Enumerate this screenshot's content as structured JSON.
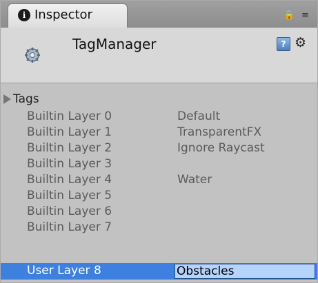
{
  "tab": {
    "label": "Inspector",
    "info_glyph": "i",
    "lock_glyph": "🔒",
    "menu_glyph": "≡"
  },
  "header": {
    "title": "TagManager",
    "component_icon": "gear-icon",
    "help_glyph": "?",
    "settings_glyph": "⚙"
  },
  "tags": {
    "foldout_label": "Tags"
  },
  "layers": [
    {
      "name": "Builtin Layer 0",
      "value": "Default"
    },
    {
      "name": "Builtin Layer 1",
      "value": "TransparentFX"
    },
    {
      "name": "Builtin Layer 2",
      "value": "Ignore Raycast"
    },
    {
      "name": "Builtin Layer 3",
      "value": ""
    },
    {
      "name": "Builtin Layer 4",
      "value": "Water"
    },
    {
      "name": "Builtin Layer 5",
      "value": ""
    },
    {
      "name": "Builtin Layer 6",
      "value": ""
    },
    {
      "name": "Builtin Layer 7",
      "value": ""
    }
  ],
  "selected_layer": {
    "name": "User Layer 8",
    "value": "Obstacles"
  },
  "colors": {
    "selection": "#3d80df",
    "edit_field": "#b5d3fb",
    "panel_bg": "#c2c2c2"
  }
}
